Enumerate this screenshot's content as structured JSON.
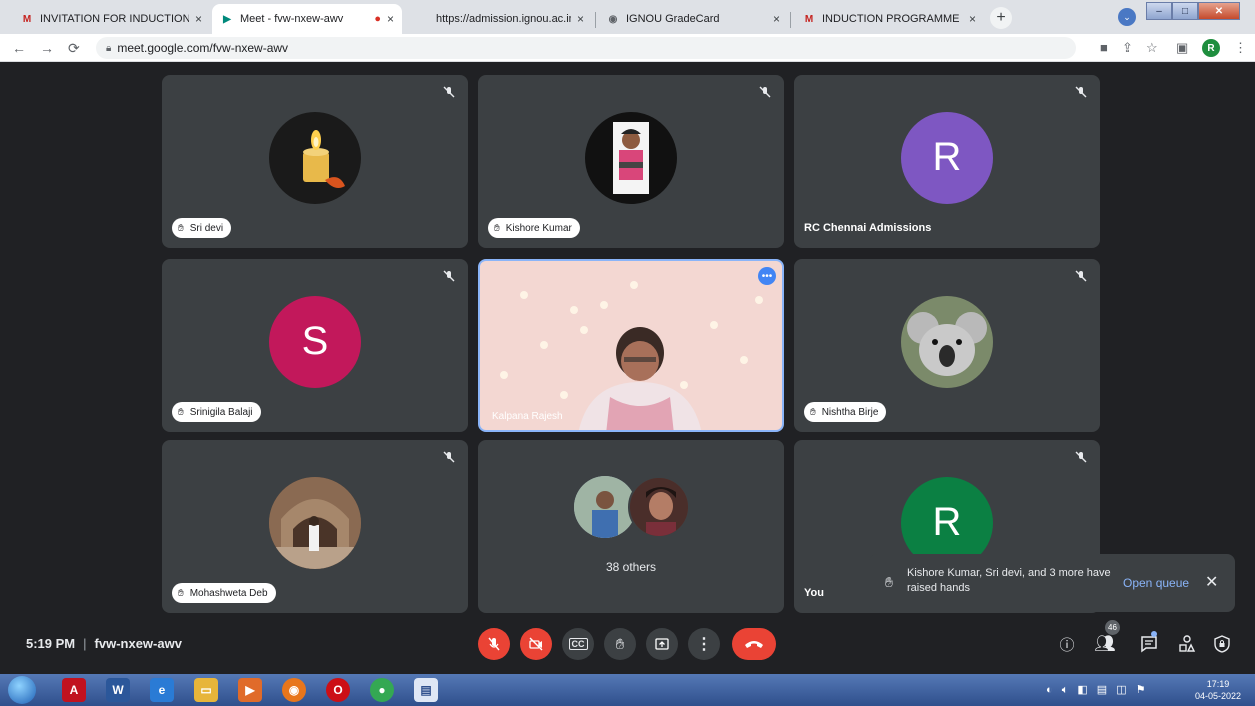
{
  "browser": {
    "tabs": [
      {
        "title": "INVITATION FOR INDUCTION ME",
        "close": "×",
        "favicon": "M",
        "favicon_color": "#c5221f"
      },
      {
        "title": "Meet - fvw-nxew-awv",
        "close": "×",
        "favicon": "▶",
        "favicon_color": "#00897b",
        "recording": "●"
      },
      {
        "title": "https://admission.ignou.ac.in/cha",
        "close": "×",
        "favicon": "",
        "favicon_color": "#ffffff"
      },
      {
        "title": "IGNOU GradeCard",
        "close": "×",
        "favicon": "◉",
        "favicon_color": "#5f6368"
      },
      {
        "title": "INDUCTION PROGRAMME IN ON",
        "close": "×",
        "favicon": "M",
        "favicon_color": "#c5221f"
      }
    ],
    "new_tab": "+",
    "url": "meet.google.com/fvw-nxew-awv",
    "profile_initial": "R"
  },
  "tiles": [
    {
      "name": "Sri devi",
      "avatar": "candle",
      "muted": true,
      "raised_hand": true
    },
    {
      "name": "Kishore Kumar",
      "avatar": "photo",
      "muted": true,
      "raised_hand": true
    },
    {
      "name": "RC Chennai Admissions",
      "avatar_initial": "R",
      "avatar_color": "#7e57c2",
      "muted": true,
      "raised_hand": false
    },
    {
      "name": "Srinigila Balaji",
      "avatar_initial": "S",
      "avatar_color": "#c2185b",
      "muted": true,
      "raised_hand": true
    },
    {
      "name": "Kalpana Rajesh",
      "video": true,
      "muted": false,
      "raised_hand": false
    },
    {
      "name": "Nishtha Birje",
      "avatar": "koala",
      "muted": true,
      "raised_hand": true
    },
    {
      "name": "Mohashweta Deb",
      "avatar": "photo",
      "muted": true,
      "raised_hand": true
    },
    {
      "name": "38 others",
      "avatar": "group",
      "muted": false,
      "raised_hand": false
    },
    {
      "name": "You",
      "avatar_initial": "R",
      "avatar_color": "#0b8043",
      "muted": true,
      "raised_hand": false
    }
  ],
  "toast": {
    "message": "Kishore Kumar, Sri devi, and 3 more have raised hands",
    "action": "Open queue",
    "close": "✕"
  },
  "meeting": {
    "time": "5:19 PM",
    "separator": "|",
    "code": "fvw-nxew-awv",
    "participant_count": "46"
  },
  "controls": {
    "mic": "mic-off",
    "camera": "camera-off",
    "captions": "CC",
    "raise_hand": "hand",
    "present": "present",
    "more": "more-vert",
    "leave": "call-end"
  },
  "taskbar": {
    "clock_time": "17:19",
    "clock_date": "04-05-2022"
  },
  "colors": {
    "stage_bg": "#202124",
    "tile_bg": "#3c4043",
    "accent": "#8ab4f8",
    "danger": "#ea4335"
  }
}
